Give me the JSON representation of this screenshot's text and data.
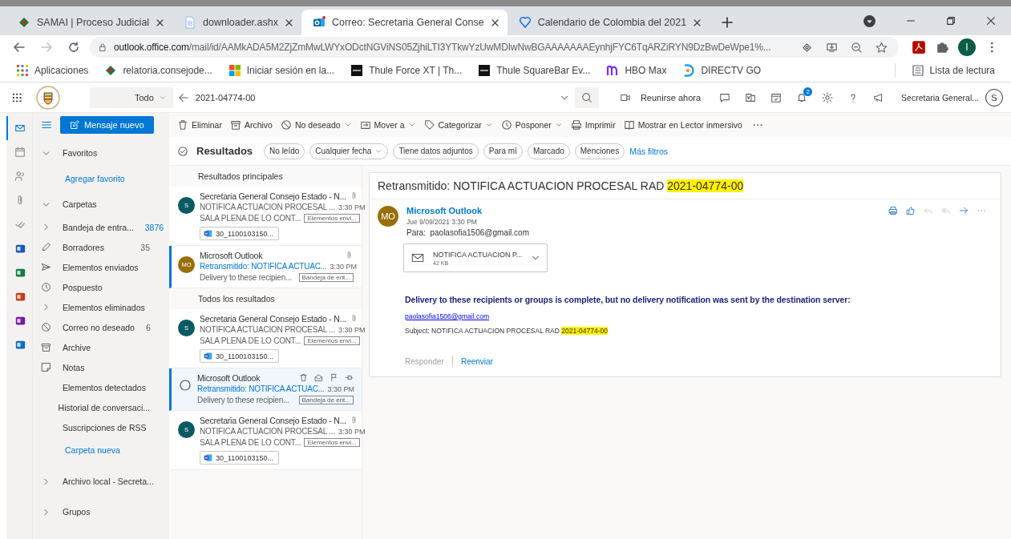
{
  "browser": {
    "tabs": [
      {
        "title": "SAMAI | Proceso Judicial",
        "kind": "samai",
        "selected": false
      },
      {
        "title": "downloader.ashx",
        "kind": "document",
        "selected": false
      },
      {
        "title": "Correo: Secretaria General Conse",
        "kind": "outlook",
        "selected": true
      },
      {
        "title": "Calendario de Colombia del 2021",
        "kind": "calendar",
        "selected": false
      }
    ],
    "url_host": "outlook.office.com",
    "url_path": "/mail/id/AAMkADA5M2ZjZmMwLWYxODctNGViNS05ZjhiLTI3YTkwYzUwMDIwNwBGAAAAAAAEynhjFYC6TqARZiRYN9DzBwDeWpe1%...",
    "profile_initial": "I",
    "bookmarks": [
      {
        "label": "Aplicaciones",
        "kind": "apps"
      },
      {
        "label": "relatoria.consejode...",
        "kind": "samai"
      },
      {
        "label": "Iniciar sesión en la...",
        "kind": "microsoft"
      },
      {
        "label": "Thule Force XT | Th...",
        "kind": "thule"
      },
      {
        "label": "Thule SquareBar Ev...",
        "kind": "thule"
      },
      {
        "label": "HBO Max",
        "kind": "hbo"
      },
      {
        "label": "DIRECTV GO",
        "kind": "directv"
      }
    ],
    "reading_list": "Lista de lectura"
  },
  "header": {
    "scope": "Todo",
    "search_value": "2021-04774-00",
    "meet_label": "Reunirse ahora",
    "notification_badge": "2",
    "account_name": "Secretaria General...",
    "account_initial": "S"
  },
  "app_rail": [
    {
      "kind": "mail",
      "selected": true
    },
    {
      "kind": "calendar",
      "selected": false
    },
    {
      "kind": "people",
      "selected": false
    },
    {
      "kind": "files",
      "selected": false
    },
    {
      "kind": "todo",
      "selected": false
    },
    {
      "kind": "word",
      "selected": false
    },
    {
      "kind": "excel",
      "selected": false
    },
    {
      "kind": "powerpoint",
      "selected": false
    },
    {
      "kind": "onenote",
      "selected": false
    },
    {
      "kind": "yammer",
      "selected": false
    }
  ],
  "new_message": "Mensaje nuevo",
  "commands": [
    {
      "label": "Eliminar",
      "kind": "trash",
      "dropdown": false
    },
    {
      "label": "Archivo",
      "kind": "archive",
      "dropdown": false
    },
    {
      "label": "No deseado",
      "kind": "ban",
      "dropdown": true
    },
    {
      "label": "Mover a",
      "kind": "move",
      "dropdown": true
    },
    {
      "label": "Categorizar",
      "kind": "tag",
      "dropdown": true
    },
    {
      "label": "Posponer",
      "kind": "clock",
      "dropdown": true
    },
    {
      "label": "Imprimir",
      "kind": "print",
      "dropdown": false
    },
    {
      "label": "Mostrar en Lector inmersivo",
      "kind": "book",
      "dropdown": false
    }
  ],
  "folder_pane": {
    "favorites": {
      "label": "Favoritos",
      "expanded": true,
      "add_link": "Agregar favorito"
    },
    "folders": {
      "label": "Carpetas",
      "expanded": true,
      "items": [
        {
          "name": "Bandeja de entra...",
          "kind": "chevron",
          "count": "3876",
          "count_highlight": true
        },
        {
          "name": "Borradores",
          "kind": "pencil",
          "count": "35",
          "count_highlight": false
        },
        {
          "name": "Elementos enviados",
          "kind": "send"
        },
        {
          "name": "Pospuesto",
          "kind": "clock"
        },
        {
          "name": "Elementos eliminados",
          "kind": "chevron"
        },
        {
          "name": "Correo no deseado",
          "kind": "ban",
          "count": "6",
          "count_highlight": false
        },
        {
          "name": "Archive",
          "kind": "archive"
        },
        {
          "name": "Notas",
          "kind": "note"
        },
        {
          "name": "Elementos detectados"
        },
        {
          "name": "Historial de conversaci..."
        },
        {
          "name": "Suscripciones de RSS"
        }
      ],
      "new_folder_link": "Carpeta nueva"
    },
    "other": [
      {
        "label": "Archivo local - Secreta...",
        "expanded": false
      },
      {
        "label": "Grupos",
        "expanded": false
      }
    ]
  },
  "message_list": {
    "heading": "Resultados",
    "filters": [
      {
        "label": "No leído",
        "dropdown": false
      },
      {
        "label": "Cualquier fecha",
        "dropdown": true
      },
      {
        "label": "Tiene datos adjuntos",
        "dropdown": false
      },
      {
        "label": "Para mí",
        "dropdown": false
      },
      {
        "label": "Marcado",
        "dropdown": false
      },
      {
        "label": "Menciones",
        "dropdown": false
      }
    ],
    "more_filters": "Más filtros",
    "groups": [
      {
        "title": "Resultados principales",
        "items": [
          {
            "sender": "Secretaria General Consejo Estado - N...",
            "initials": "S",
            "color": "#0b5a63",
            "subject": "NOTIFICA ACTUACION PROCESAL ...",
            "time": "3:30 PM",
            "preview": "SALA PLENA DE LO CONT...",
            "folder": "Elementos envi...",
            "attachment": "30_1100103150...",
            "has_attachment": true,
            "unread": false,
            "selected": false,
            "hovered": false
          },
          {
            "sender": "Microsoft Outlook",
            "initials": "MO",
            "color": "#986f0b",
            "subject": "Retransmitido: NOTIFICA ACTUAC...",
            "time": "3:30 PM",
            "preview": "Delivery to these recipien...",
            "folder": "Bandeja de ent...",
            "has_attachment": true,
            "unread": true,
            "selected": true,
            "hovered": false
          }
        ]
      },
      {
        "title": "Todos los resultados",
        "items": [
          {
            "sender": "Secretaria General Consejo Estado - N...",
            "initials": "S",
            "color": "#0b5a63",
            "subject": "NOTIFICA ACTUACION PROCESAL ...",
            "time": "3:30 PM",
            "preview": "SALA PLENA DE LO CONT...",
            "folder": "Elementos envi...",
            "attachment": "30_1100103150...",
            "has_attachment": true,
            "unread": false,
            "selected": false,
            "hovered": false
          },
          {
            "sender": "Microsoft Outlook",
            "subject": "Retransmitido: NOTIFICA ACTUAC...",
            "time": "3:30 PM",
            "preview": "Delivery to these recipien...",
            "folder": "Bandeja de ent...",
            "unread": true,
            "selected": true,
            "hovered": true
          },
          {
            "sender": "Secretaria General Consejo Estado - N...",
            "initials": "S",
            "color": "#0b5a63",
            "subject": "NOTIFICA ACTUACION PROCESAL ...",
            "time": "3:30 PM",
            "preview": "SALA PLENA DE LO CONT...",
            "folder": "Elementos envi...",
            "attachment": "30_1100103150...",
            "has_attachment": true,
            "unread": false,
            "selected": false,
            "hovered": false
          }
        ]
      }
    ]
  },
  "message": {
    "subject": "Retransmitido: NOTIFICA ACTUACION PROCESAL RAD",
    "subject_highlight": "2021-04774-00",
    "sender": "Microsoft Outlook",
    "initials": "MO",
    "date": "Jue 9/09/2021 3:30 PM",
    "to_label": "Para:",
    "to": "paolasofia1506@gmail.com",
    "actions": [
      {
        "kind": "print",
        "disabled": false
      },
      {
        "kind": "like",
        "disabled": false
      },
      {
        "kind": "reply",
        "disabled": true
      },
      {
        "kind": "reply_all",
        "disabled": true
      },
      {
        "kind": "forward",
        "disabled": false
      },
      {
        "kind": "more",
        "disabled": false
      }
    ],
    "attachment": {
      "name": "NOTIFICA ACTUACION P...",
      "size": "42 KB"
    },
    "notice": "Delivery to these recipients or groups is complete, but no delivery notification was sent by the destination server:",
    "recipient_link": "paolasofia1506@gmail.com",
    "subject_line": "Subject: NOTIFICA ACTUACION PROCESAL RAD",
    "subject_line_highlight": "2021-04774-00",
    "footer": [
      {
        "label": "Responder",
        "disabled": true
      },
      {
        "label": "Reenviar",
        "disabled": false
      }
    ]
  }
}
